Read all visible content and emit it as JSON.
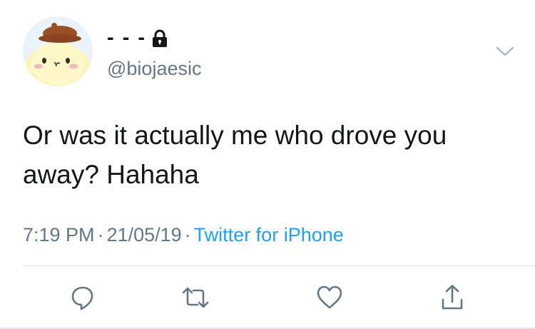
{
  "tweet": {
    "author": {
      "display_name": "- - -",
      "handle": "@biojaesic",
      "protected": true,
      "avatar": "pompompurin-avatar"
    },
    "text_line1": "Or was it actually me who drove you",
    "text_line2": "away? Hahaha",
    "time": "7:19 PM",
    "date": "21/05/19",
    "separator": "·",
    "source": "Twitter for iPhone"
  },
  "actions": [
    {
      "name": "reply",
      "icon": "reply-icon"
    },
    {
      "name": "retweet",
      "icon": "retweet-icon"
    },
    {
      "name": "like",
      "icon": "heart-icon"
    },
    {
      "name": "share",
      "icon": "share-icon"
    }
  ],
  "colors": {
    "text": "#14171a",
    "secondary": "#657786",
    "link": "#1da1f2",
    "divider": "#e1e8ed",
    "action_icon": "#657786"
  }
}
